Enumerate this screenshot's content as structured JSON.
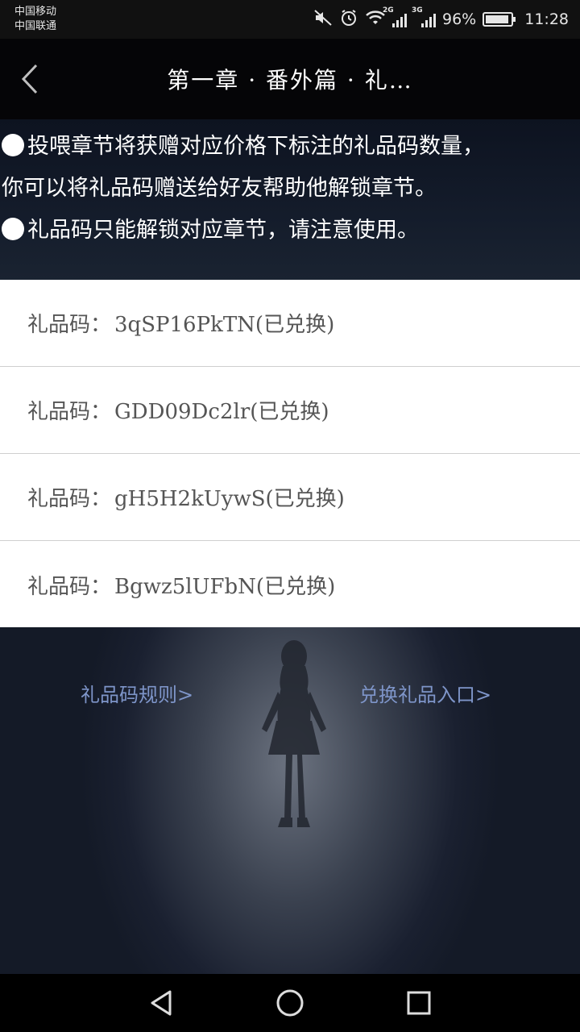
{
  "status_bar": {
    "carrier_1": "中国移动",
    "carrier_2": "中国联通",
    "net_1": "2G",
    "net_2": "3G",
    "battery": "96%",
    "time": "11:28"
  },
  "header": {
    "title": "第一章 · 番外篇 · 礼…",
    "back_icon": "chevron-left-icon"
  },
  "notice": {
    "line_1": "投喂章节将获赠对应价格下标注的礼品码数量，",
    "line_2": "你可以将礼品码赠送给好友帮助他解锁章节。",
    "line_3": "礼品码只能解锁对应章节，请注意使用。"
  },
  "gift_codes": [
    {
      "label": "礼品码：",
      "code": "3qSP16PkTN(已兑换)"
    },
    {
      "label": "礼品码：",
      "code": "GDD09Dc2lr(已兑换)"
    },
    {
      "label": "礼品码：",
      "code": "gH5H2kUywS(已兑换)"
    },
    {
      "label": "礼品码：",
      "code": "Bgwz5lUFbN(已兑换)"
    }
  ],
  "links": {
    "rules": "礼品码规则>",
    "redeem": "兑换礼品入口>"
  },
  "colors": {
    "link": "#7e95c9",
    "header_bg": "#050507",
    "row_text": "#555555"
  }
}
